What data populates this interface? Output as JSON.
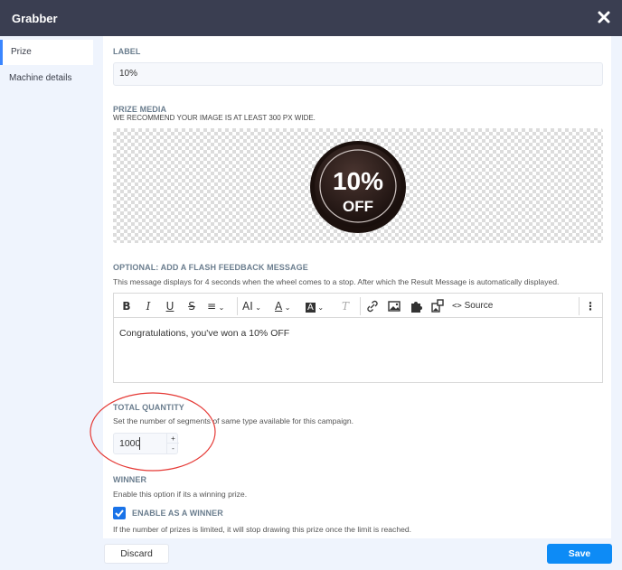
{
  "header": {
    "title": "Grabber",
    "close_icon": "close-icon"
  },
  "sidebar": {
    "items": [
      {
        "label": "Prize",
        "active": true
      },
      {
        "label": "Machine details",
        "active": false
      }
    ]
  },
  "form": {
    "label": {
      "title": "LABEL",
      "value": "10%"
    },
    "prize_media": {
      "title": "PRIZE MEDIA",
      "help": "WE RECOMMEND YOUR IMAGE IS AT LEAST 300 PX WIDE.",
      "image_text_line1": "10%",
      "image_text_line2": "OFF"
    },
    "flash_message": {
      "title": "OPTIONAL: ADD A FLASH FEEDBACK MESSAGE",
      "help": "This message displays for 4 seconds when the wheel comes to a stop. After which the Result Message is automatically displayed.",
      "toolbar": {
        "bold": "B",
        "italic": "I",
        "underline": "U",
        "strikethrough": "S",
        "align": "≡",
        "font_size": "AI",
        "font_color": "A",
        "bg_color": "A",
        "clear_format": "T",
        "source_label": "Source",
        "more": "⋮"
      },
      "content": "Congratulations, you've won a 10% OFF"
    },
    "total_quantity": {
      "title": "TOTAL QUANTITY",
      "help": "Set the number of segments of same type available for this campaign.",
      "value": "1000",
      "increment": "+",
      "decrement": "-"
    },
    "winner": {
      "title": "WINNER",
      "help": "Enable this option if its a winning prize.",
      "checkbox_label": "ENABLE AS A WINNER",
      "checked": true,
      "note": "If the number of prizes is limited, it will stop drawing this prize once the limit is reached."
    }
  },
  "footer": {
    "discard_label": "Discard",
    "save_label": "Save"
  },
  "colors": {
    "header_bg": "#3a3e51",
    "accent": "#0d8bf6",
    "checkbox": "#1a73e8",
    "annotation": "#e53935"
  }
}
